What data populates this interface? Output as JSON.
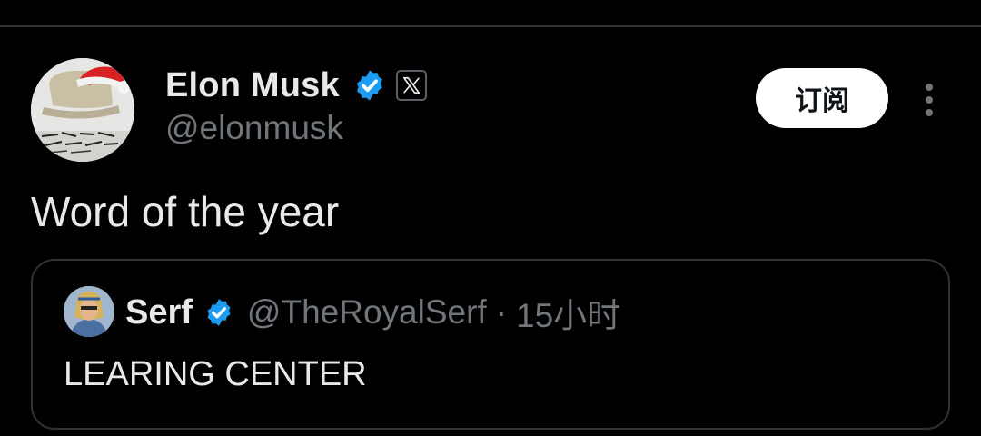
{
  "tweet": {
    "author": {
      "display_name": "Elon Musk",
      "handle": "@elonmusk",
      "verified_icon": "verified-badge-icon",
      "affiliate_icon": "x-logo-icon"
    },
    "subscribe_label": "订阅",
    "more_icon": "more-vertical-icon",
    "text": "Word of the year",
    "quoted": {
      "author": {
        "display_name": "Serf",
        "handle": "@TheRoyalSerf",
        "verified_icon": "verified-badge-icon"
      },
      "separator": "·",
      "time": "15小时",
      "text": "LEARING CENTER"
    }
  },
  "colors": {
    "background": "#000000",
    "primary_text": "#e7e9ea",
    "secondary_text": "#71767b",
    "verified_blue": "#1d9bf0",
    "border": "#2f3336"
  }
}
